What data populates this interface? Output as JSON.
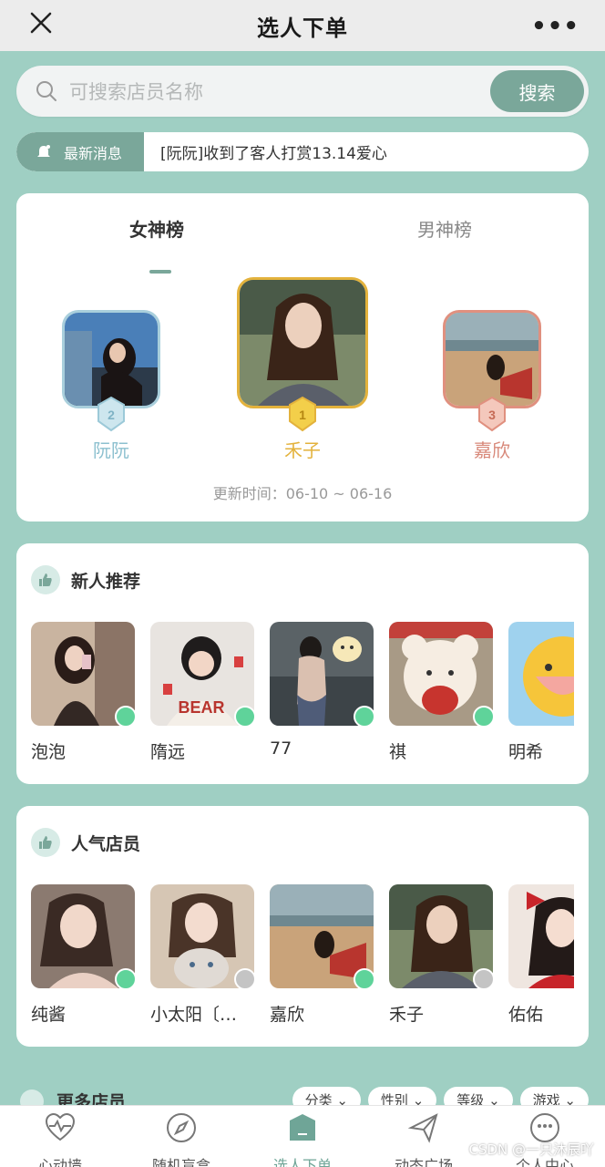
{
  "header": {
    "title": "选人下单",
    "more": "•••"
  },
  "search": {
    "placeholder": "可搜索店员名称",
    "button": "搜索"
  },
  "news": {
    "tag": "最新消息",
    "message": "[阮阮]收到了客人打赏13.14爱心"
  },
  "ranking": {
    "tabs": [
      "女神榜",
      "男神榜"
    ],
    "active_tab": "女神榜",
    "podium": [
      {
        "rank": 2,
        "name": "阮阮",
        "color": "#8cc0cf"
      },
      {
        "rank": 1,
        "name": "禾子",
        "color": "#e3b23c"
      },
      {
        "rank": 3,
        "name": "嘉欣",
        "color": "#d8897a"
      }
    ],
    "update_time": "更新时间：06-10 ~ 06-16"
  },
  "new_recommend": {
    "title": "新人推荐",
    "items": [
      {
        "name": "泡泡",
        "online": true
      },
      {
        "name": "隋远",
        "online": true
      },
      {
        "name": "77",
        "online": true
      },
      {
        "name": "祺",
        "online": true
      },
      {
        "name": "明希",
        "online": false
      }
    ]
  },
  "popular": {
    "title": "人气店员",
    "items": [
      {
        "name": "纯酱",
        "online": true
      },
      {
        "name": "小太阳〔…",
        "online": false
      },
      {
        "name": "嘉欣",
        "online": true
      },
      {
        "name": "禾子",
        "online": false
      },
      {
        "name": "佑佑",
        "online": false
      }
    ]
  },
  "more_staff": {
    "title": "更多店员",
    "filters": [
      "分类",
      "性别",
      "等级",
      "游戏"
    ]
  },
  "bottom_nav": [
    {
      "label": "心动墙",
      "icon": "heart-pulse-icon"
    },
    {
      "label": "随机盲盒",
      "icon": "compass-icon"
    },
    {
      "label": "选人下单",
      "icon": "home-icon",
      "active": true
    },
    {
      "label": "动态广场",
      "icon": "send-icon"
    },
    {
      "label": "个人中心",
      "icon": "smile-icon"
    }
  ],
  "watermark": "CSDN @一只沐辰吖",
  "colors": {
    "accent": "#7aa79a",
    "background": "#9fcfc3",
    "online": "#5fd39a",
    "offline": "#c4c4c4"
  }
}
